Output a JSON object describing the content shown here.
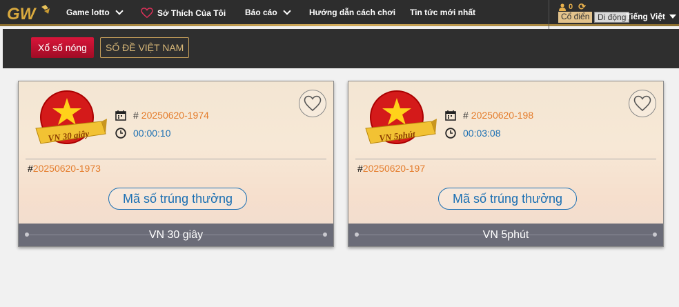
{
  "nav": {
    "items": [
      {
        "label": "Game lotto"
      },
      {
        "label": "Sở Thích Của Tôi"
      },
      {
        "label": "Báo cáo"
      },
      {
        "label": "Hướng dẫn cách chơi"
      },
      {
        "label": "Tin tức mới nhất"
      }
    ],
    "balance": "0",
    "mode_classic": "Cổ điển",
    "mode_mobile": "Di động",
    "language": "Tiếng Việt"
  },
  "subnav": {
    "hot_label": "Xổ số nóng",
    "de_label": "SỐ ĐỀ VIỆT NAM"
  },
  "cards": [
    {
      "badge_text": "VN 30 giây",
      "current_issue": "20250620-1974",
      "countdown": "00:00:10",
      "previous_issue": "20250620-1973",
      "button_label": "Mã số trúng thưởng",
      "footer_title": "VN 30 giây"
    },
    {
      "badge_text": "VN 5phút",
      "current_issue": "20250620-198",
      "countdown": "00:03:08",
      "previous_issue": "20250620-197",
      "button_label": "Mã số trúng thưởng",
      "footer_title": "VN 5phút"
    }
  ],
  "symbols": {
    "hash": "#"
  },
  "icons": [
    "gw-logo",
    "chevron-down-icon",
    "heart-icon",
    "user-icon",
    "refresh-icon",
    "calendar-icon",
    "clock-icon",
    "favorite-heart-icon"
  ],
  "colors": {
    "accent_gold": "#d4ad5c",
    "hot_red": "#d9153a",
    "issue_orange": "#e47c2b",
    "timer_blue": "#1a6fb3"
  }
}
